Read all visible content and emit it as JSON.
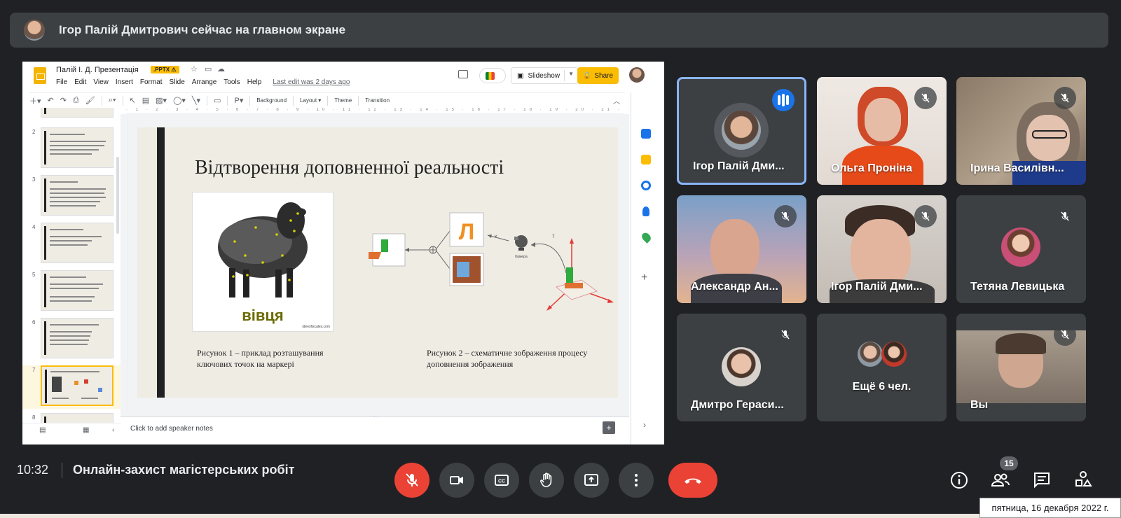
{
  "presenter_bar": {
    "text": "Ігор Палій Дмитрович сейчас на главном экране"
  },
  "slides_app": {
    "doc_title": "Палій І. Д. Презентація",
    "badge": ".PPTX ⚠",
    "menu": [
      "File",
      "Edit",
      "View",
      "Insert",
      "Format",
      "Slide",
      "Arrange",
      "Tools",
      "Help"
    ],
    "last_edit": "Last edit was 2 days ago",
    "slideshow_label": "Slideshow",
    "share_label": "Share",
    "toolbar": {
      "background": "Background",
      "layout": "Layout ▾",
      "theme": "Theme",
      "transition": "Transition"
    },
    "ruler_marks": "· 1 · 2 · 3 · 4 · 5 · 6 · 7 · 8 · 9 · 10 · 11 · 12 · 13 · 14 · 15 · 16 · 17 · 18 · 19 · 20 · 21 · 22 · 23 · 24 · 25 · 26 · 27 · 28 · 29 · 30 · 31 · 32 · 33",
    "filmstrip_numbers": [
      "2",
      "3",
      "4",
      "5",
      "6",
      "7",
      "8"
    ],
    "current_slide": {
      "title": "Відтворення доповненної реальності",
      "image_label": "вівця",
      "image_credit": "ideesfiscales.com",
      "caption_1": "Рисунок 1 – приклад розташування ключових точок на маркері",
      "caption_2": "Рисунок 2 – схематичне зображення процесу доповнення зображення",
      "diagram": {
        "marker_letter": "Л",
        "camera_label": "Камера",
        "k_label": "K",
        "t_label": "T"
      }
    },
    "speaker_notes_placeholder": "Click to add speaker notes"
  },
  "participants": [
    {
      "name": "Ігор Палій Дми...",
      "state": "speaking"
    },
    {
      "name": "Ольга Проніна",
      "state": "muted"
    },
    {
      "name": "Ірина Василівн...",
      "state": "muted"
    },
    {
      "name": "Александр Ан...",
      "state": "muted"
    },
    {
      "name": "Ігор Палій Дми...",
      "state": "muted"
    },
    {
      "name": "Тетяна Левицька",
      "state": "muted"
    },
    {
      "name": "Дмитро Гераси...",
      "state": "muted"
    },
    {
      "name": "Ещё 6 чел.",
      "state": "overflow"
    },
    {
      "name": "Вы",
      "state": "muted"
    }
  ],
  "bottom_bar": {
    "time": "10:32",
    "meeting_title": "Онлайн-захист магістерських робіт",
    "people_count": "15",
    "date_tooltip": "пятница, 16 декабря 2022 г."
  },
  "colors": {
    "background": "#202124",
    "tile": "#3c4043",
    "accent": "#8ab4f8",
    "danger": "#ea4335",
    "speaking": "#1a73e8",
    "share": "#fbbc04"
  },
  "icons": [
    "mic-off-icon",
    "camera-icon",
    "captions-icon",
    "raise-hand-icon",
    "present-icon",
    "more-icon",
    "hangup-icon",
    "info-icon",
    "people-icon",
    "chat-icon",
    "activities-icon"
  ]
}
